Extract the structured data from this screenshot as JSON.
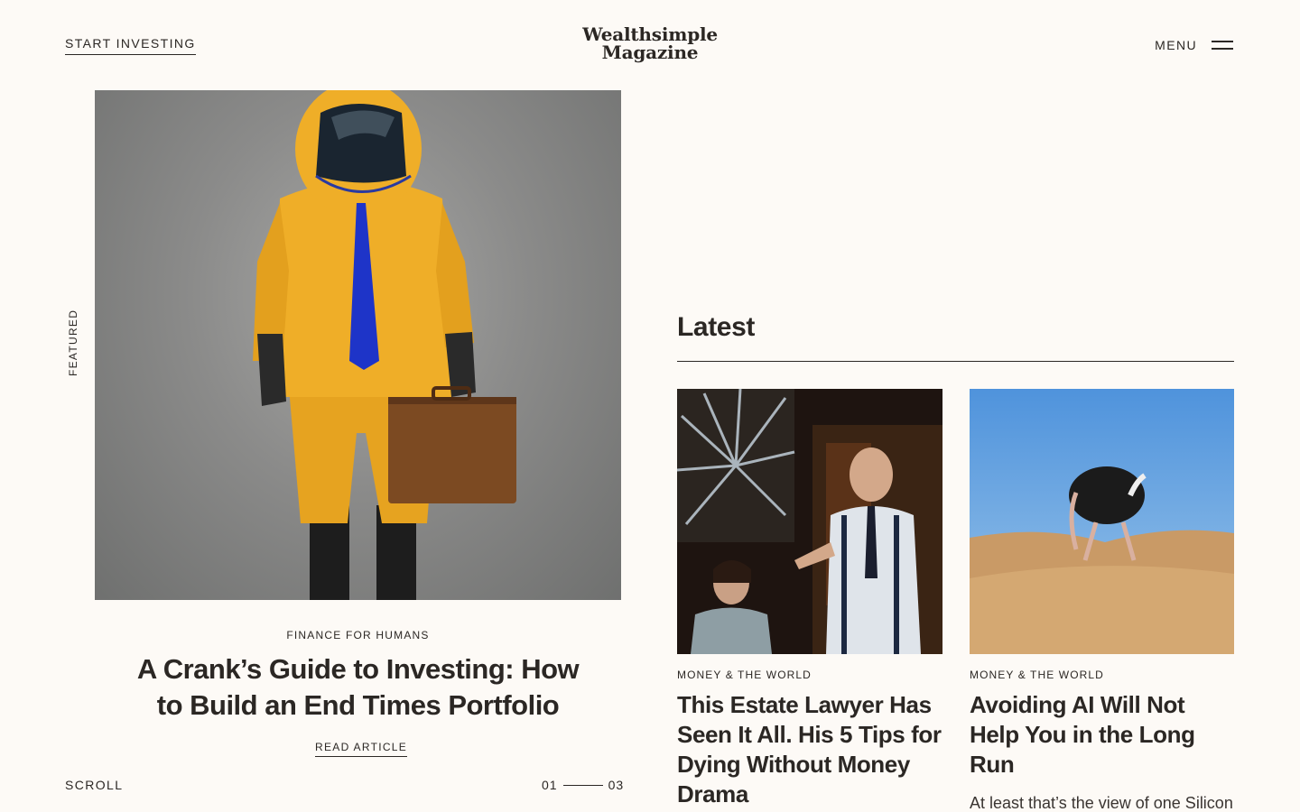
{
  "header": {
    "start_investing": "START INVESTING",
    "logo_line1": "Wealthsimple",
    "logo_line2": "Magazine",
    "menu_label": "MENU"
  },
  "featured": {
    "section_label": "FEATURED",
    "category": "FINANCE FOR HUMANS",
    "title": "A Crank’s Guide to Investing: How to Build an End Times Portfolio",
    "cta": "READ ARTICLE",
    "scroll_label": "SCROLL",
    "pager_current": "01",
    "pager_total": "03"
  },
  "latest": {
    "heading": "Latest",
    "cards": [
      {
        "category": "MONEY & THE WORLD",
        "title": "This Estate Lawyer Has Seen It All. His 5 Tips for Dying Without Money Drama",
        "excerpt": ""
      },
      {
        "category": "MONEY & THE WORLD",
        "title": "Avoiding AI Will Not Help You in the Long Run",
        "excerpt": "At least that’s the view of one Silicon Valley insider who has"
      }
    ]
  },
  "colors": {
    "background": "#fdfaf6",
    "text": "#2b2724"
  }
}
